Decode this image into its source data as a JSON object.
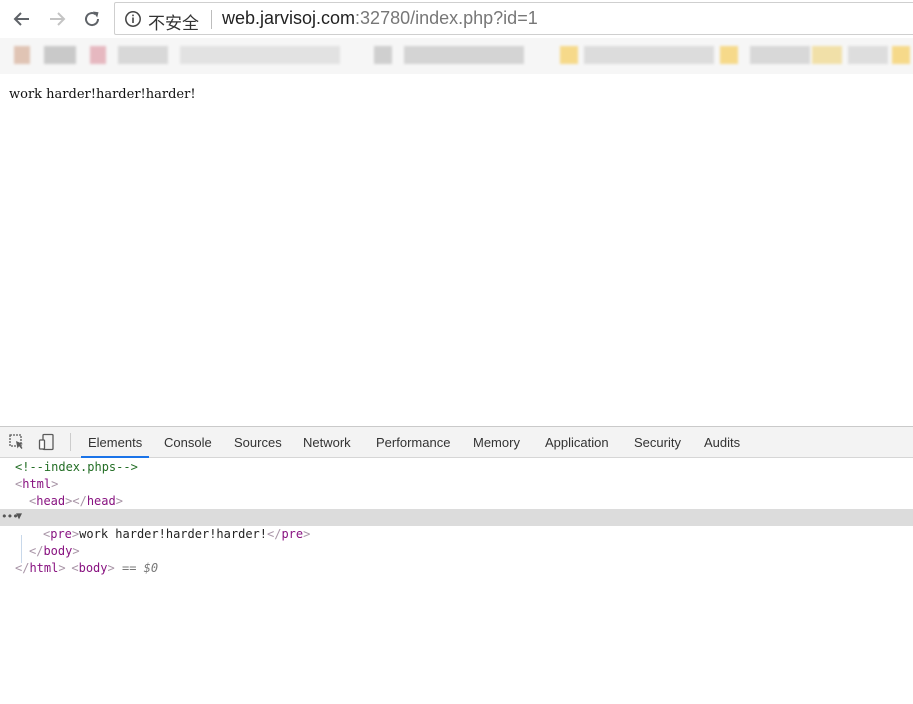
{
  "browser": {
    "security_label": "不安全",
    "url_host": "web.jarvisoj.com",
    "url_rest": ":32780/index.php?id=1",
    "icons": {
      "back": "back-arrow-icon",
      "forward": "forward-arrow-icon",
      "reload": "reload-icon",
      "info": "info-icon"
    }
  },
  "page": {
    "body_text": "work harder!harder!harder!"
  },
  "devtools": {
    "tabs": [
      "Elements",
      "Console",
      "Sources",
      "Network",
      "Performance",
      "Memory",
      "Application",
      "Security",
      "Audits"
    ],
    "active_tab": "Elements",
    "accent_color": "#1a73e8",
    "dom": {
      "comment": "<!--index.phps-->",
      "html_open": "html",
      "head": "head",
      "body": "body",
      "selected_marker": "== $0",
      "pre": "pre",
      "pre_text": "work harder!harder!harder!"
    }
  }
}
